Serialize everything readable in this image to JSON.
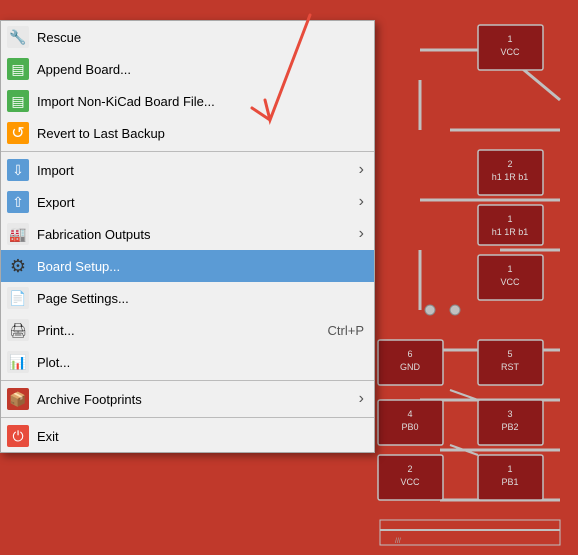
{
  "menu": {
    "items": [
      {
        "id": "rescue",
        "label": "Rescue",
        "icon": "🔧",
        "iconType": "rescue",
        "shortcut": "",
        "hasSubmenu": false,
        "separator_after": false
      },
      {
        "id": "append-board",
        "label": "Append Board...",
        "icon": "📋",
        "iconType": "append",
        "shortcut": "",
        "hasSubmenu": false,
        "separator_after": false
      },
      {
        "id": "import-nonkicad",
        "label": "Import Non-KiCad Board File...",
        "icon": "📥",
        "iconType": "import-nonkicad",
        "shortcut": "",
        "hasSubmenu": false,
        "separator_after": false
      },
      {
        "id": "revert",
        "label": "Revert to Last Backup",
        "icon": "↩",
        "iconType": "revert",
        "shortcut": "",
        "hasSubmenu": false,
        "separator_after": true
      },
      {
        "id": "import",
        "label": "Import",
        "icon": "⬇",
        "iconType": "import",
        "shortcut": "",
        "hasSubmenu": true,
        "separator_after": false
      },
      {
        "id": "export",
        "label": "Export",
        "icon": "⬆",
        "iconType": "export",
        "shortcut": "",
        "hasSubmenu": true,
        "separator_after": false
      },
      {
        "id": "fabrication",
        "label": "Fabrication Outputs",
        "icon": "🏭",
        "iconType": "fabrication",
        "shortcut": "",
        "hasSubmenu": true,
        "separator_after": false
      },
      {
        "id": "board-setup",
        "label": "Board Setup...",
        "icon": "⚙",
        "iconType": "boardsetup",
        "shortcut": "",
        "hasSubmenu": false,
        "highlighted": true,
        "separator_after": false
      },
      {
        "id": "page-settings",
        "label": "Page Settings...",
        "icon": "📄",
        "iconType": "pagesettings",
        "shortcut": "",
        "hasSubmenu": false,
        "separator_after": false
      },
      {
        "id": "print",
        "label": "Print...",
        "icon": "🖨",
        "iconType": "print",
        "shortcut": "Ctrl+P",
        "hasSubmenu": false,
        "separator_after": false
      },
      {
        "id": "plot",
        "label": "Plot...",
        "icon": "📊",
        "iconType": "plot",
        "shortcut": "",
        "hasSubmenu": false,
        "separator_after": true
      },
      {
        "id": "archive-footprints",
        "label": "Archive Footprints",
        "icon": "📦",
        "iconType": "archive",
        "shortcut": "",
        "hasSubmenu": true,
        "separator_after": true
      },
      {
        "id": "exit",
        "label": "Exit",
        "icon": "⏻",
        "iconType": "exit",
        "shortcut": "",
        "hasSubmenu": false,
        "separator_after": false
      }
    ]
  },
  "icons": {
    "submenu_arrow": "›"
  }
}
